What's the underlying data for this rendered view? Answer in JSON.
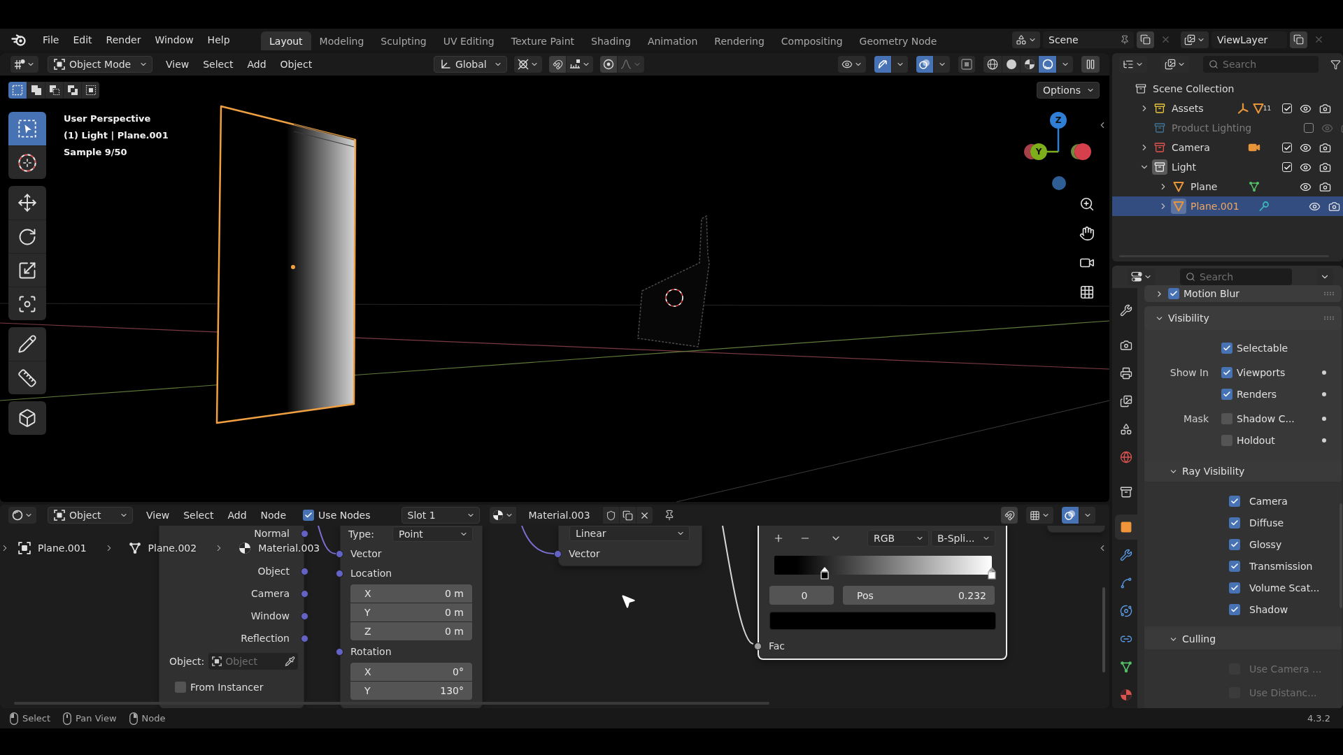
{
  "top_bar": {
    "menu": [
      "File",
      "Edit",
      "Render",
      "Window",
      "Help"
    ],
    "workspaces": [
      {
        "label": "Layout",
        "selected": true
      },
      {
        "label": "Modeling",
        "selected": false
      },
      {
        "label": "Sculpting",
        "selected": false
      },
      {
        "label": "UV Editing",
        "selected": false
      },
      {
        "label": "Texture Paint",
        "selected": false
      },
      {
        "label": "Shading",
        "selected": false
      },
      {
        "label": "Animation",
        "selected": false
      },
      {
        "label": "Rendering",
        "selected": false
      },
      {
        "label": "Compositing",
        "selected": false
      },
      {
        "label": "Geometry Node",
        "selected": false
      }
    ],
    "scene": "Scene",
    "view_layer": "ViewLayer"
  },
  "viewport": {
    "header": {
      "mode": "Object Mode",
      "menu": [
        "View",
        "Select",
        "Add",
        "Object"
      ],
      "orientation": "Global",
      "snap": false,
      "proportional": false,
      "gizmos": true,
      "overlays": true,
      "xray": false,
      "shading": [
        {
          "kind": "wireframe",
          "selected": false
        },
        {
          "kind": "solid",
          "selected": false
        },
        {
          "kind": "material",
          "selected": false
        },
        {
          "kind": "rendered",
          "selected": true
        }
      ]
    },
    "select_modes": [
      {
        "kind": "new",
        "selected": true
      },
      {
        "kind": "extend",
        "selected": false
      },
      {
        "kind": "subtract",
        "selected": false
      },
      {
        "kind": "invert",
        "selected": false
      },
      {
        "kind": "intersect",
        "selected": false
      }
    ],
    "options": "Options",
    "info": [
      "User Perspective",
      "(1) Light | Plane.001",
      "Sample 9/50"
    ],
    "tools": [
      [
        {
          "kind": "select_box",
          "selected": true
        },
        {
          "kind": "cursor",
          "selected": false
        }
      ],
      [
        {
          "kind": "move",
          "selected": false
        },
        {
          "kind": "rotate",
          "selected": false
        },
        {
          "kind": "scale",
          "selected": false
        },
        {
          "kind": "transform",
          "selected": false
        }
      ],
      [
        {
          "kind": "annotate",
          "selected": false
        },
        {
          "kind": "measure",
          "selected": false
        }
      ],
      [
        {
          "kind": "add_cube",
          "selected": false
        }
      ]
    ],
    "gizmo": [
      {
        "kind": "front",
        "label": "Z",
        "color": "#2f7fd6"
      },
      {
        "kind": "behind",
        "color": "#a8404a"
      },
      {
        "kind": "front",
        "label": "Y",
        "color": "#7fae1c"
      },
      {
        "kind": "behind",
        "color": "#6f8a3a"
      },
      {
        "kind": "front",
        "color": "#d6404c"
      },
      {
        "kind": "front",
        "color": "#2f5e94"
      }
    ]
  },
  "node_editor": {
    "header": {
      "type": "Object",
      "menu": [
        "View",
        "Select",
        "Add",
        "Node"
      ],
      "use_nodes": {
        "label": "Use Nodes",
        "checked": true
      },
      "slot": "Slot 1",
      "material": "Material.003",
      "snap": false,
      "overlays": true
    },
    "breadcrumbs": [
      {
        "kind": "object",
        "label": "Plane.001"
      },
      {
        "kind": "mesh",
        "label": "Plane.002"
      },
      {
        "kind": "material",
        "label": "Material.003"
      }
    ],
    "nodes": [
      {
        "kind": "texture_coordinate",
        "selected": false,
        "outputs": [
          "Normal",
          "Object",
          "Camera",
          "Window",
          "Reflection"
        ],
        "object_field": {
          "label": "Object:",
          "placeholder": "Object"
        },
        "from_instancer": {
          "label": "From Instancer",
          "checked": false
        }
      },
      {
        "kind": "mapping",
        "selected": false,
        "type": {
          "label": "Type:",
          "value": "Point"
        },
        "inputs": [
          {
            "label": "Vector"
          },
          {
            "label": "Location",
            "fields": [
              {
                "axis": "X",
                "value": "0 m"
              },
              {
                "axis": "Y",
                "value": "0 m"
              },
              {
                "axis": "Z",
                "value": "0 m"
              }
            ]
          },
          {
            "label": "Rotation",
            "fields": [
              {
                "axis": "X",
                "value": "0°"
              },
              {
                "axis": "Y",
                "value": "130°"
              }
            ]
          }
        ]
      },
      {
        "kind": "gradient",
        "selected": false,
        "mode": "Linear",
        "inputs": [
          "Vector"
        ]
      },
      {
        "kind": "color_ramp",
        "selected": true,
        "color_mode": "RGB",
        "interpolation": "B-Spli...",
        "stops": [
          {
            "level": 0.232,
            "color": "#000000",
            "selected": true
          },
          {
            "level": 1,
            "color": "#ffffff",
            "selected": false
          }
        ],
        "index": "0",
        "position_label": "Pos",
        "position_value": "0.232",
        "inputs": [
          "Fac"
        ]
      },
      {
        "kind": "fragment",
        "selected": false
      }
    ]
  },
  "outliner": {
    "search": {
      "placeholder": "Search"
    },
    "tree": [
      {
        "label": "Scene Collection",
        "kind": "scene_collection",
        "selected": false,
        "active": false,
        "children": [
          {
            "label": "Assets",
            "kind": "collection",
            "color": "#e9c53c",
            "expanded": false,
            "checked": true,
            "selected": false,
            "active": false,
            "extras": [
              {
                "kind": "armature"
              },
              {
                "kind": "mesh",
                "count": "11"
              }
            ]
          },
          {
            "label": "Product Lighting",
            "kind": "collection",
            "color": "#3f7396",
            "checked": false,
            "selected": false,
            "active": false
          },
          {
            "label": "Camera",
            "kind": "collection",
            "color": "#e0524c",
            "expanded": false,
            "checked": true,
            "selected": false,
            "active": false,
            "extras": [
              {
                "kind": "camera"
              }
            ]
          },
          {
            "label": "Light",
            "kind": "collection",
            "color": "#e6e6e6",
            "expanded": true,
            "checked": true,
            "selected": false,
            "active": true,
            "children": [
              {
                "label": "Plane",
                "kind": "object",
                "expanded": false,
                "selected": false,
                "active": false,
                "extras": [
                  {
                    "kind": "mesh_data"
                  }
                ]
              },
              {
                "label": "Plane.001",
                "kind": "object",
                "expanded": false,
                "selected": true,
                "active": true,
                "extras": [
                  {
                    "kind": "pin"
                  }
                ]
              }
            ]
          }
        ]
      }
    ]
  },
  "properties": {
    "search": {
      "placeholder": "Search"
    },
    "tabs": [
      [
        {
          "kind": "tool",
          "selected": false
        }
      ],
      [
        {
          "kind": "render",
          "selected": false
        },
        {
          "kind": "output",
          "selected": false
        },
        {
          "kind": "view_layer",
          "selected": false
        },
        {
          "kind": "scene",
          "selected": false
        },
        {
          "kind": "world",
          "selected": false
        }
      ],
      [
        {
          "kind": "collection",
          "selected": false
        }
      ],
      [
        {
          "kind": "object",
          "selected": true
        },
        {
          "kind": "modifiers",
          "selected": false
        },
        {
          "kind": "particles",
          "selected": false
        },
        {
          "kind": "physics",
          "selected": false
        },
        {
          "kind": "constraints",
          "selected": false
        },
        {
          "kind": "data",
          "selected": false
        },
        {
          "kind": "material",
          "selected": false
        }
      ]
    ],
    "panels": [
      {
        "title": "Motion Blur",
        "expanded": false,
        "checked": true
      },
      {
        "title": "Visibility",
        "expanded": true,
        "rows": [
          {
            "option": "Selectable",
            "checked": true,
            "animatable": false
          },
          {
            "label": "Show In",
            "option": "Viewports",
            "checked": true,
            "animatable": true
          },
          {
            "option": "Renders",
            "checked": true,
            "animatable": true
          },
          {
            "label": "Mask",
            "option": "Shadow C...",
            "checked": false,
            "animatable": true
          },
          {
            "option": "Holdout",
            "checked": false,
            "animatable": true
          }
        ],
        "subpanels": [
          {
            "title": "Ray Visibility",
            "expanded": true,
            "rows": [
              {
                "option": "Camera",
                "checked": true,
                "disabled": false
              },
              {
                "option": "Diffuse",
                "checked": true,
                "disabled": false
              },
              {
                "option": "Glossy",
                "checked": true,
                "disabled": false
              },
              {
                "option": "Transmission",
                "checked": true,
                "disabled": false
              },
              {
                "option": "Volume Scat...",
                "checked": true,
                "disabled": false
              },
              {
                "option": "Shadow",
                "checked": true,
                "disabled": false
              }
            ]
          },
          {
            "title": "Culling",
            "expanded": true,
            "rows": [
              {
                "option": "Use Camera ...",
                "checked": false,
                "disabled": true
              },
              {
                "option": "Use Distanc...",
                "checked": false,
                "disabled": true
              }
            ]
          }
        ]
      }
    ]
  },
  "status_bar": {
    "hints": [
      {
        "kind": "left",
        "label": "Select"
      },
      {
        "kind": "middle",
        "label": "Pan View"
      },
      {
        "kind": "right",
        "label": "Node"
      }
    ],
    "version": "4.3.2"
  }
}
